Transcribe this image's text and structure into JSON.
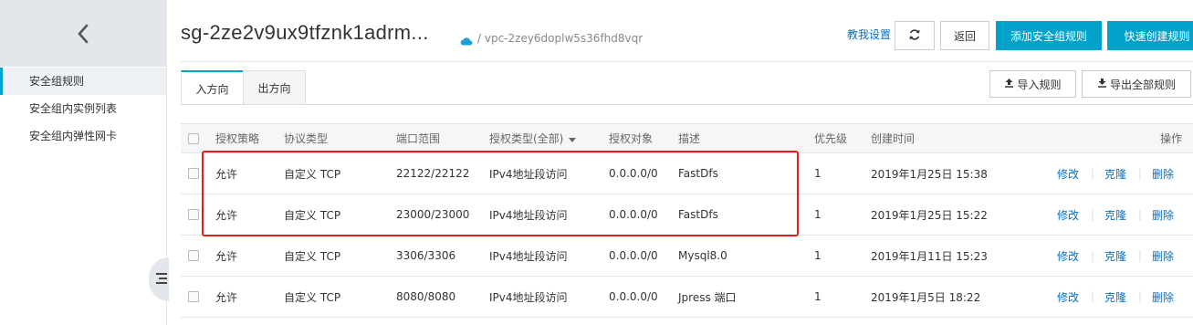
{
  "sidebar": {
    "items": [
      {
        "label": "安全组规则",
        "active": true
      },
      {
        "label": "安全组内实例列表",
        "active": false
      },
      {
        "label": "安全组内弹性网卡",
        "active": false
      }
    ]
  },
  "header": {
    "title": "sg-2ze2v9ux9tfznk1adrm...",
    "vpc": "/ vpc-2zey6doplw5s36fhd8vqr",
    "help_link": "教我设置",
    "back_label": "返回",
    "add_rule_label": "添加安全组规则",
    "quick_create_label": "快速创建规则"
  },
  "tabs": [
    {
      "label": "入方向",
      "active": true
    },
    {
      "label": "出方向",
      "active": false
    }
  ],
  "actions": {
    "import_label": "导入规则",
    "export_label": "导出全部规则"
  },
  "table": {
    "headers": {
      "policy": "授权策略",
      "protocol": "协议类型",
      "port": "端口范围",
      "auth_type": "授权类型(全部)",
      "auth_object": "授权对象",
      "description": "描述",
      "priority": "优先级",
      "created": "创建时间",
      "actions": "操作"
    },
    "rows": [
      {
        "policy": "允许",
        "protocol": "自定义 TCP",
        "port": "22122/22122",
        "auth_type": "IPv4地址段访问",
        "auth_object": "0.0.0.0/0",
        "description": "FastDfs",
        "priority": "1",
        "created": "2019年1月25日 15:38",
        "edit": "修改",
        "clone": "克隆",
        "delete": "删除"
      },
      {
        "policy": "允许",
        "protocol": "自定义 TCP",
        "port": "23000/23000",
        "auth_type": "IPv4地址段访问",
        "auth_object": "0.0.0.0/0",
        "description": "FastDfs",
        "priority": "1",
        "created": "2019年1月25日 15:22",
        "edit": "修改",
        "clone": "克隆",
        "delete": "删除"
      },
      {
        "policy": "允许",
        "protocol": "自定义 TCP",
        "port": "3306/3306",
        "auth_type": "IPv4地址段访问",
        "auth_object": "0.0.0.0/0",
        "description": "Mysql8.0",
        "priority": "1",
        "created": "2019年1月11日 15:23",
        "edit": "修改",
        "clone": "克隆",
        "delete": "删除"
      },
      {
        "policy": "允许",
        "protocol": "自定义 TCP",
        "port": "8080/8080",
        "auth_type": "IPv4地址段访问",
        "auth_object": "0.0.0.0/0",
        "description": "Jpress 端口",
        "priority": "1",
        "created": "2019年1月5日 18:22",
        "edit": "修改",
        "clone": "克隆",
        "delete": "删除"
      }
    ]
  },
  "colors": {
    "accent": "#00a2ca",
    "link": "#0070cc",
    "highlight": "#e02020"
  }
}
